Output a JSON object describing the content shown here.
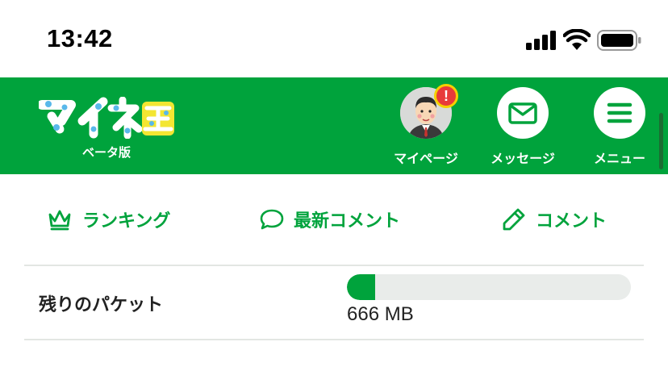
{
  "status_bar": {
    "time": "13:42"
  },
  "header": {
    "logo_text": "マイネ王",
    "beta_label": "ベータ版",
    "buttons": [
      {
        "label": "マイページ",
        "icon": "avatar",
        "has_alert": true,
        "alert_symbol": "!"
      },
      {
        "label": "メッセージ",
        "icon": "envelope-icon"
      },
      {
        "label": "メニュー",
        "icon": "hamburger-icon"
      }
    ]
  },
  "nav": {
    "items": [
      {
        "label": "ランキング",
        "icon": "crown-icon"
      },
      {
        "label": "最新コメント",
        "icon": "speech-bubble-icon"
      },
      {
        "label": "コメント",
        "icon": "pencil-icon"
      }
    ]
  },
  "packet": {
    "label": "残りのパケット",
    "value_text": "666 MB",
    "fill_fraction": 0.1
  },
  "colors": {
    "brand_green": "#00a33c",
    "track_gray": "#e9ecea",
    "alert_red": "#e83a3a",
    "alert_ring": "#f5d000"
  }
}
